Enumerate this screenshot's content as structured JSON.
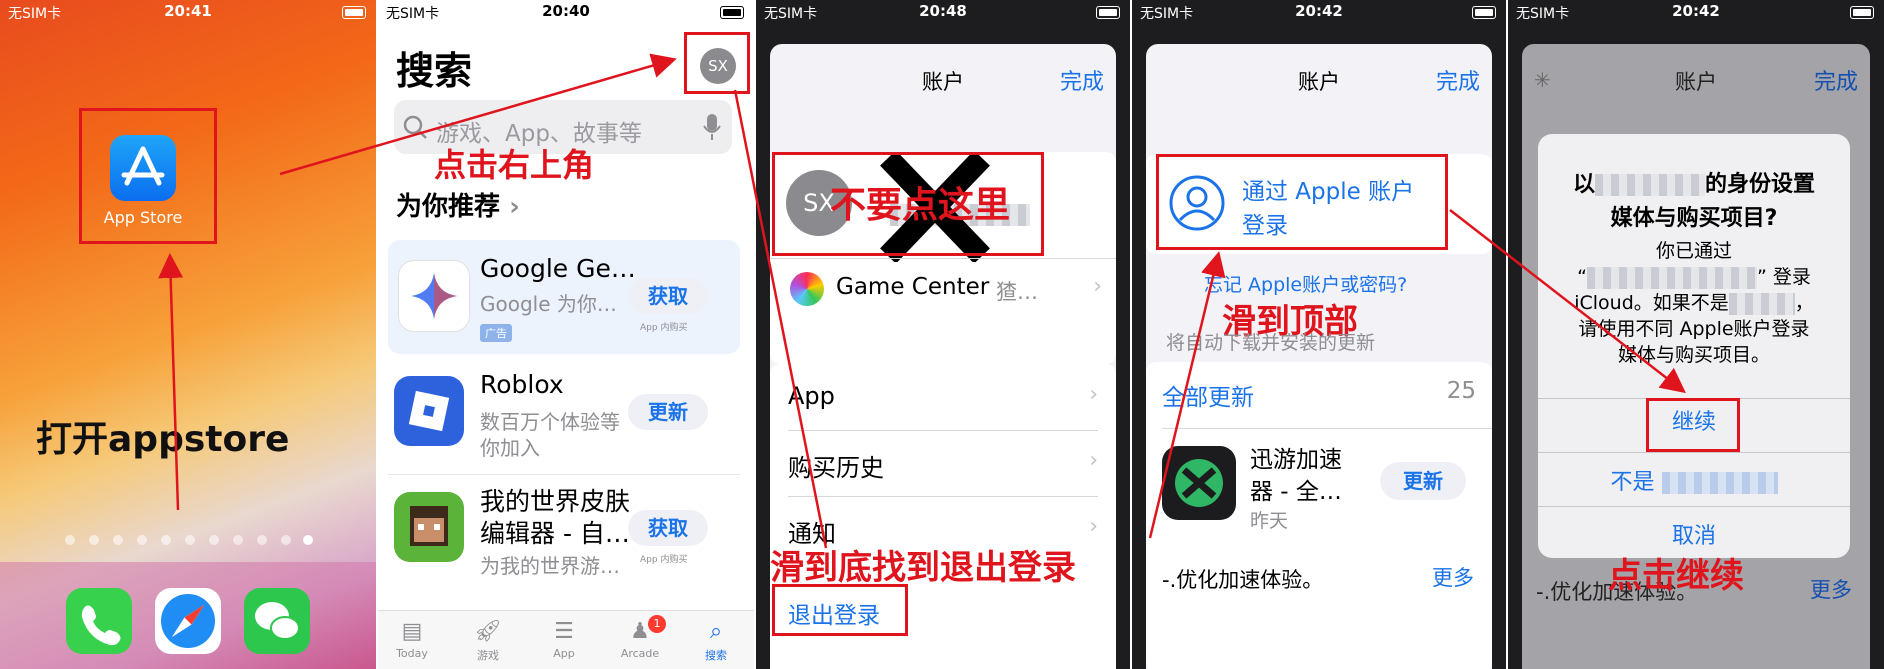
{
  "status_bars": [
    {
      "carrier": "无SIM卡",
      "time": "20:41"
    },
    {
      "carrier": "无SIM卡",
      "time": "20:40"
    },
    {
      "carrier": "无SIM卡",
      "time": "20:48"
    },
    {
      "carrier": "无SIM卡",
      "time": "20:42"
    },
    {
      "carrier": "无SIM卡",
      "time": "20:42"
    }
  ],
  "home": {
    "app_label": "App Store",
    "annotation": "打开appstore",
    "dock": [
      "phone-icon",
      "safari-icon",
      "wechat-icon"
    ]
  },
  "search": {
    "title": "搜索",
    "avatar": "SX",
    "placeholder": "游戏、App、故事等",
    "annotation": "点击右上角",
    "section": "为你推荐",
    "apps": [
      {
        "name": "Google Ge…",
        "subtitle": "Google 为你…",
        "badge": "广告",
        "button": "获取",
        "note": "App 内购买"
      },
      {
        "name": "Roblox",
        "subtitle1": "数百万个体验等",
        "subtitle2": "你加入",
        "button": "更新"
      },
      {
        "name1": "我的世界皮肤",
        "name2": "编辑器 - 自…",
        "subtitle": "为我的世界游…",
        "button": "获取",
        "note": "App 内购买"
      }
    ],
    "tabs": [
      {
        "label": "Today",
        "icon": "today-icon"
      },
      {
        "label": "游戏",
        "icon": "rocket-icon"
      },
      {
        "label": "App",
        "icon": "stack-icon"
      },
      {
        "label": "Arcade",
        "icon": "arcade-icon",
        "badge": "1"
      },
      {
        "label": "搜索",
        "icon": "search-icon"
      }
    ]
  },
  "account": {
    "title": "账户",
    "done": "完成",
    "avatar": "SX",
    "annotation_dont": "不要点这里",
    "game_center": "Game Center",
    "game_center_value": "猹…",
    "rows": [
      "App",
      "购买历史",
      "通知"
    ],
    "annotation_scroll": "滑到底找到退出登录",
    "sign_out": "退出登录"
  },
  "account_top": {
    "title": "账户",
    "done": "完成",
    "sign_in_line1": "通过 Apple 账户",
    "sign_in_line2": "登录",
    "forgot": "忘记 Apple账户或密码?",
    "annotation": "滑到顶部",
    "auto_text": "将自动下载并安装的更新",
    "update_all": "全部更新",
    "update_count": "25",
    "app_name1": "迅游加速",
    "app_name2": "器 - 全…",
    "app_date": "昨天",
    "update_btn": "更新",
    "note": "-.优化加速体验。",
    "more": "更多"
  },
  "alert": {
    "title": "账户",
    "done": "完成",
    "heading_prefix": "以",
    "heading_suffix": "的身份设置",
    "heading_line2": "媒体与购买项目?",
    "body1": "你已通过",
    "body2_a": "“",
    "body2_b": "” 登录",
    "body3_a": "iCloud。如果不是",
    "body3_b": "，",
    "body4": "请使用不同 Apple账户登录",
    "body5": "媒体与购买项目。",
    "continue": "继续",
    "not_prefix": "不是",
    "cancel": "取消",
    "annotation": "点击继续",
    "note": "-.优化加速体验。",
    "more": "更多"
  }
}
